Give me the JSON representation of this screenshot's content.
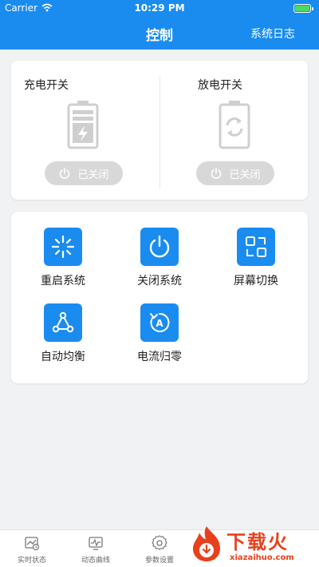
{
  "status_bar": {
    "carrier": "Carrier",
    "time": "10:29 PM"
  },
  "header": {
    "title": "控制",
    "log_label": "系统日志"
  },
  "switches": {
    "charge": {
      "label": "充电开关",
      "state": "已关闭"
    },
    "discharge": {
      "label": "放电开关",
      "state": "已关闭"
    }
  },
  "actions": [
    {
      "label": "重启系统",
      "icon": "restart-icon"
    },
    {
      "label": "关闭系统",
      "icon": "power-icon"
    },
    {
      "label": "屏幕切换",
      "icon": "screen-switch-icon"
    },
    {
      "label": "自动均衡",
      "icon": "auto-balance-icon"
    },
    {
      "label": "电流归零",
      "icon": "current-reset-icon"
    }
  ],
  "tabs": [
    {
      "label": "实时状态",
      "icon": "realtime-status-icon"
    },
    {
      "label": "动态曲线",
      "icon": "dynamic-curve-icon"
    },
    {
      "label": "参数设置",
      "icon": "gear-icon"
    }
  ],
  "watermark": {
    "text": "下载火",
    "domain": "xiazaihuo.com"
  },
  "colors": {
    "primary": "#1a8cf0",
    "background": "#f1f2f4",
    "disabled": "#d8d8d8",
    "watermark": "#e8401c"
  }
}
